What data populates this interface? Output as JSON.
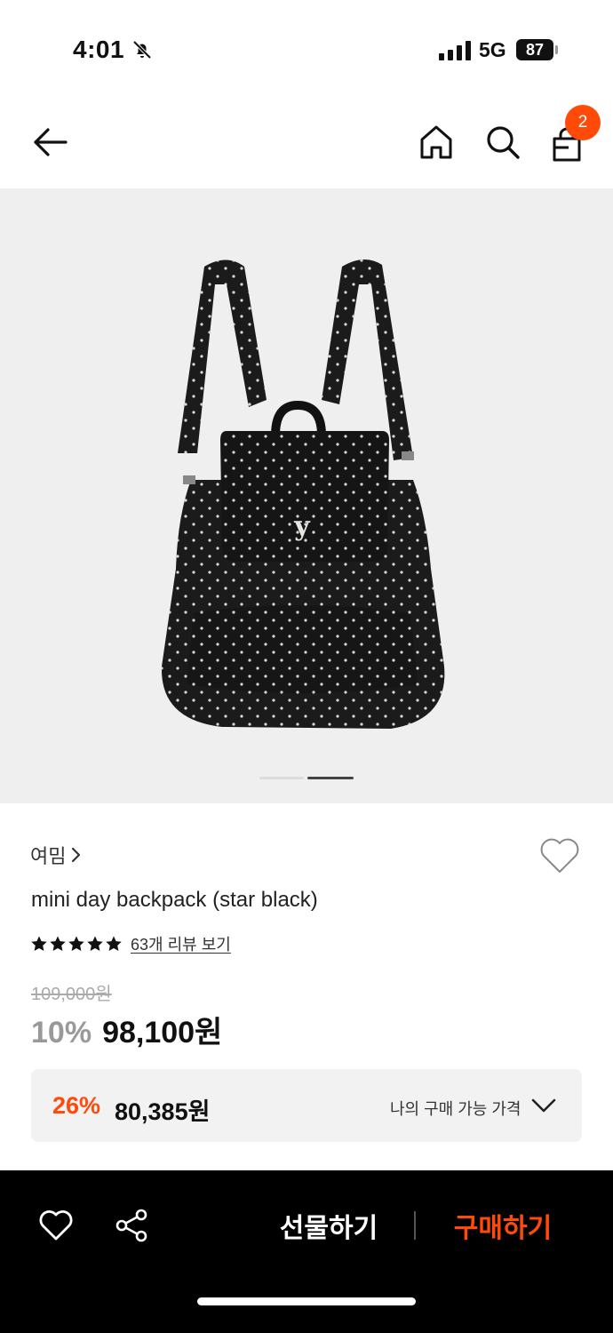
{
  "status_bar": {
    "time": "4:01",
    "network": "5G",
    "battery": "87"
  },
  "nav": {
    "cart_count": "2"
  },
  "product": {
    "brand": "여밈",
    "title": "mini day backpack (star black)",
    "rating": {
      "stars": 5,
      "review_text": "63개 리뷰 보기"
    },
    "original_price": "109,000원",
    "discount_rate": "10%",
    "sale_price": "98,100원",
    "image_page": 2,
    "image_pages": 2
  },
  "my_price": {
    "discount_rate": "26%",
    "price": "80,385원",
    "label": "나의 구매 가능 가격"
  },
  "bottom_bar": {
    "gift_label": "선물하기",
    "buy_label": "구매하기"
  },
  "colors": {
    "accent": "#ff4a0a",
    "hero_bg": "#efefef",
    "bar_bg": "#000000"
  }
}
